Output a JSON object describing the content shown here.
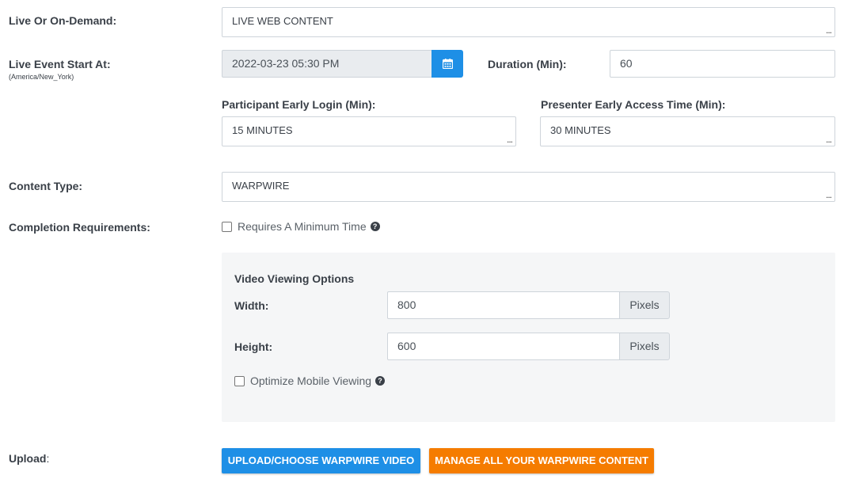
{
  "live_or_on_demand": {
    "label": "Live Or On-Demand:",
    "value": "LIVE WEB CONTENT"
  },
  "live_event_start": {
    "label": "Live Event Start At:",
    "timezone": "(America/New_York)",
    "value": "2022-03-23 05:30 PM"
  },
  "duration": {
    "label": "Duration (Min):",
    "value": "60"
  },
  "participant_early_login": {
    "label": "Participant Early Login (Min):",
    "value": "15 MINUTES"
  },
  "presenter_early_access": {
    "label": "Presenter Early Access Time (Min):",
    "value": "30 MINUTES"
  },
  "content_type": {
    "label": "Content Type:",
    "value": "WARPWIRE"
  },
  "completion": {
    "label": "Completion Requirements:",
    "checkbox_label": "Requires A Minimum Time",
    "checked": false
  },
  "video_options": {
    "title": "Video Viewing Options",
    "width_label": "Width:",
    "width_value": "800",
    "height_label": "Height:",
    "height_value": "600",
    "unit": "Pixels",
    "mobile_label": "Optimize Mobile Viewing",
    "mobile_checked": false
  },
  "upload": {
    "label": "Upload",
    "colon": ":",
    "upload_button": "UPLOAD/CHOOSE WARPWIRE VIDEO",
    "manage_button": "MANAGE ALL YOUR WARPWIRE CONTENT"
  },
  "select_dots": "...",
  "colors": {
    "primary": "#1e8fe6",
    "orange": "#f57c00",
    "panel_bg": "#f5f6f7"
  },
  "icons": {
    "calendar": "calendar-icon",
    "help": "question-circle-icon"
  }
}
